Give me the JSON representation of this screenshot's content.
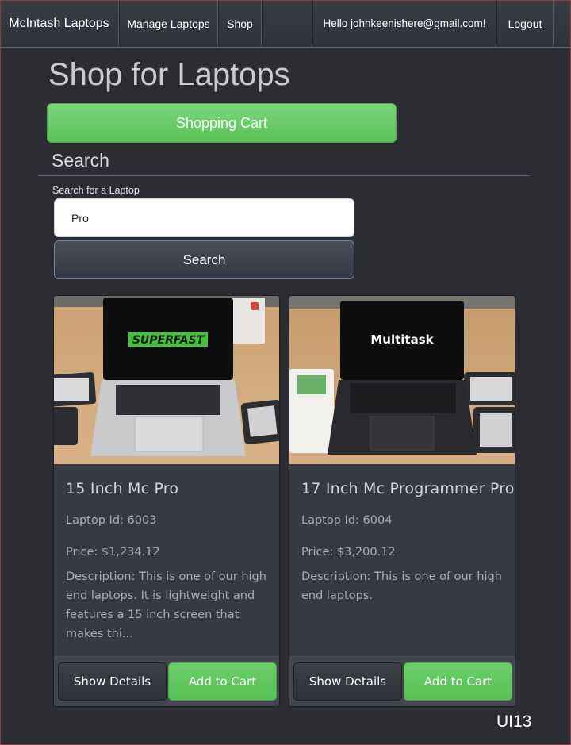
{
  "navbar": {
    "brand": "McIntash Laptops",
    "manage": "Manage Laptops",
    "shop": "Shop",
    "hello": "Hello johnkeenishere@gmail.com!",
    "logout": "Logout"
  },
  "page": {
    "title": "Shop for Laptops",
    "cart_button": "Shopping Cart",
    "search_heading": "Search",
    "search_label": "Search for a Laptop",
    "search_value": "Pro",
    "search_button": "Search",
    "tag": "UI13"
  },
  "products": [
    {
      "name": "15 Inch Mc Pro",
      "laptop_id": "Laptop Id: 6003",
      "price": "Price: $1,234.12",
      "description": "Description: This is one of our high end laptops. It is lightweight and features a 15 inch screen that makes thi...",
      "screen_text": "SUPERFAST",
      "details_button": "Show Details",
      "add_button": "Add to Cart"
    },
    {
      "name": "17 Inch Mc Programmer Pro",
      "laptop_id": "Laptop Id: 6004",
      "price": "Price: $3,200.12",
      "description": "Description: This is one of our high end laptops.",
      "screen_text": "Multitask",
      "details_button": "Show Details",
      "add_button": "Add to Cart"
    }
  ],
  "colors": {
    "background": "#2b2d33",
    "accent_green": "#5cc45b",
    "navbar": "#34373d"
  }
}
